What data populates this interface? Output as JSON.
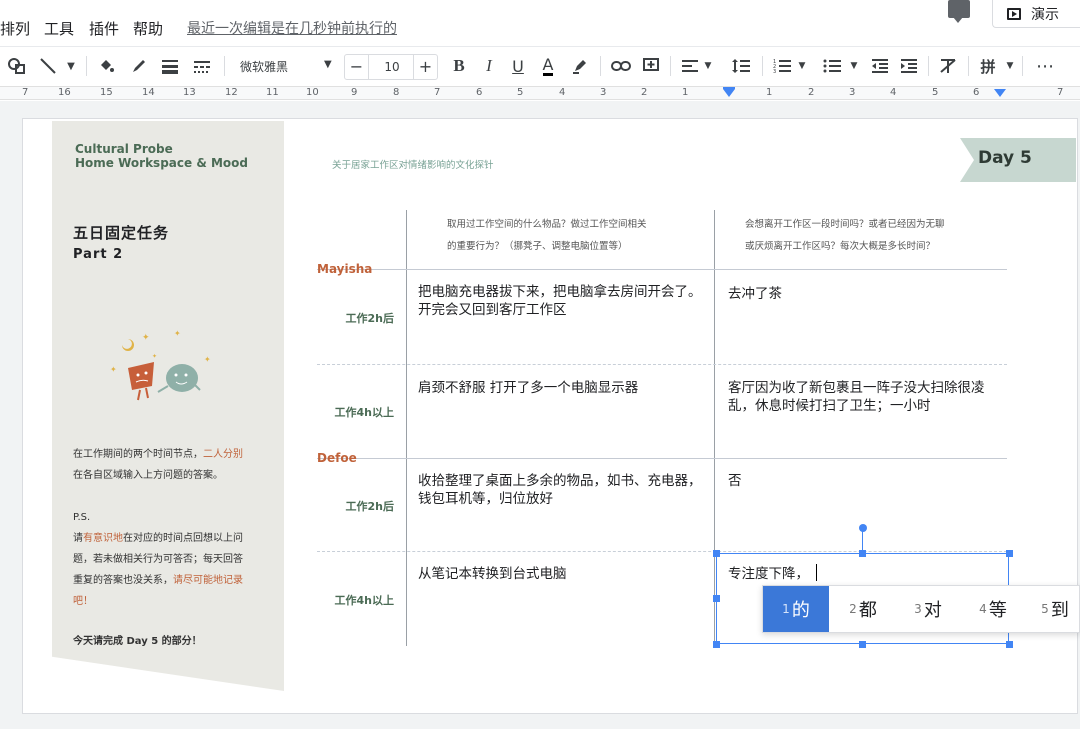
{
  "menu": {
    "items": [
      "排列",
      "工具",
      "插件",
      "帮助"
    ],
    "last_edit": "最近一次编辑是在几秒钟前执行的",
    "present_label": "演示"
  },
  "toolbar": {
    "font_name": "微软雅黑",
    "font_size": "10",
    "bold": "B",
    "italic": "I",
    "underline": "U",
    "text_color": "A",
    "input_method": "拼",
    "more": "⋯"
  },
  "ruler": {
    "numbers": [
      "7",
      "16",
      "15",
      "14",
      "13",
      "12",
      "11",
      "10",
      "9",
      "8",
      "7",
      "6",
      "5",
      "4",
      "3",
      "2",
      "1",
      "1",
      "2",
      "3",
      "4",
      "5",
      "6",
      "7"
    ]
  },
  "banner": {
    "title_line1": "Cultural Probe",
    "title_line2": "Home Workspace & Mood",
    "task_title": "五日固定任务",
    "part": "Part 2",
    "p1_a": "在工作期间的两个时间节点，",
    "p1_hl": "二人分别",
    "p1_b": "在各自区域输入上方问题的答案。",
    "ps": "P.S.",
    "p2_a": "请",
    "p2_hl1": "有意识地",
    "p2_b": "在对应的时间点回想以上问",
    "p2_c": "题，若未做相关行为可答否；每天回答",
    "p2_d": "重复的答案也没关系，",
    "p2_hl2": "请尽可能地记录",
    "p2_e": "吧！",
    "p3": "今天请完成 Day 5 的部分！"
  },
  "slide": {
    "subtitle": "关于居家工作区对情绪影响的文化探针",
    "day": "Day 5"
  },
  "table": {
    "col1_header_line1": "取用过工作空间的什么物品？做过工作空间相关",
    "col1_header_line2": "的重要行为？（挪凳子、调整电脑位置等）",
    "col2_header_line1": "会想离开工作区一段时间吗？或者已经因为无聊",
    "col2_header_line2": "或厌烦离开工作区吗？每次大概是多长时间？",
    "person1": "Mayisha",
    "person2": "Defoe",
    "rows": [
      {
        "time": "工作2h后",
        "c1": "把电脑充电器拔下来，把电脑拿去房间开会了。开完会又回到客厅工作区",
        "c2": "去冲了茶"
      },
      {
        "time": "工作4h以上",
        "c1": "肩颈不舒服 打开了多一个电脑显示器",
        "c2": "客厅因为收了新包裹且一阵子没大扫除很凌乱，休息时候打扫了卫生；一小时"
      },
      {
        "time": "工作2h后",
        "c1": "收拾整理了桌面上多余的物品，如书、充电器，钱包耳机等，归位放好",
        "c2": "否"
      },
      {
        "time": "工作4h以上",
        "c1": "从笔记本转换到台式电脑",
        "c2": "专注度下降，"
      }
    ]
  },
  "ime": {
    "candidates": [
      {
        "n": "1",
        "w": "的"
      },
      {
        "n": "2",
        "w": "都"
      },
      {
        "n": "3",
        "w": "对"
      },
      {
        "n": "4",
        "w": "等"
      },
      {
        "n": "5",
        "w": "到"
      }
    ]
  }
}
